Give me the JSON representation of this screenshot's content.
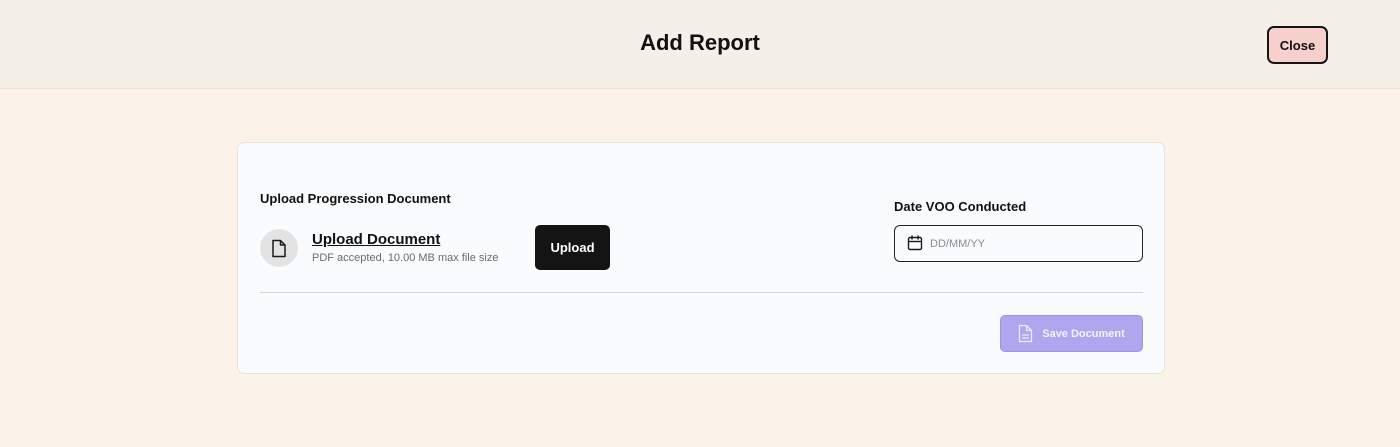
{
  "header": {
    "title": "Add Report",
    "close_label": "Close"
  },
  "upload": {
    "section_label": "Upload Progression Document",
    "link_label": "Upload Document",
    "hint": "PDF accepted, 10.00 MB max file size",
    "button_label": "Upload",
    "icon": "file-icon"
  },
  "date": {
    "label": "Date VOO Conducted",
    "placeholder": "DD/MM/YY",
    "value": "",
    "icon": "calendar-icon"
  },
  "actions": {
    "save_label": "Save Document",
    "save_icon": "document-icon"
  },
  "colors": {
    "page_bg": "#fbf3e9",
    "header_bg": "#f4efe7",
    "close_bg": "#f7cfcd",
    "primary_dark": "#141414",
    "save_disabled_bg": "#aea6ee"
  }
}
